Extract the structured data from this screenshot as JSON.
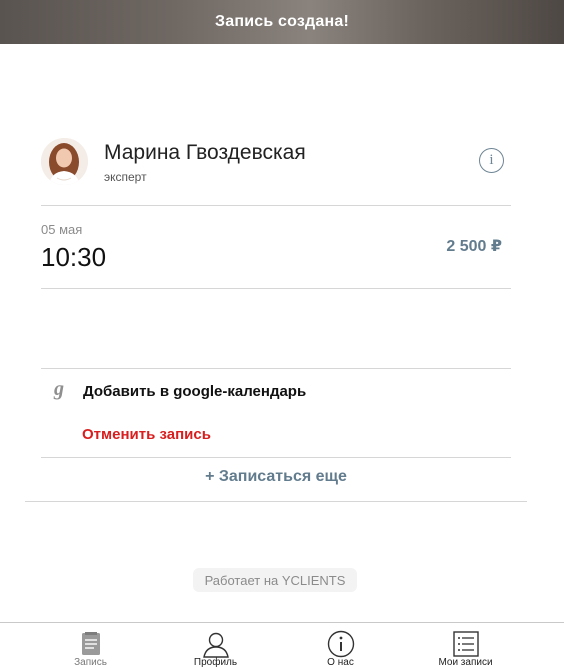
{
  "header": {
    "title": "Запись создана!"
  },
  "master": {
    "name": "Марина Гвоздевская",
    "role": "эксперт",
    "info_icon": "i"
  },
  "appointment": {
    "date": "05 мая",
    "time": "10:30",
    "price": "2 500 ₽"
  },
  "actions": {
    "google_icon": "g",
    "add_to_google": "Добавить в google-календарь",
    "cancel": "Отменить запись",
    "book_more": "+ Записаться еще"
  },
  "footer": {
    "powered_by": "Работает на YCLIENTS"
  },
  "tabbar": {
    "items": [
      {
        "label": "Запись",
        "icon": "booking-icon"
      },
      {
        "label": "Профиль",
        "icon": "profile-icon"
      },
      {
        "label": "О нас",
        "icon": "info-icon"
      },
      {
        "label": "Мои записи",
        "icon": "list-icon"
      }
    ]
  },
  "colors": {
    "accent": "#627c8e",
    "danger": "#d81e1e",
    "muted": "#8b8b8b"
  }
}
